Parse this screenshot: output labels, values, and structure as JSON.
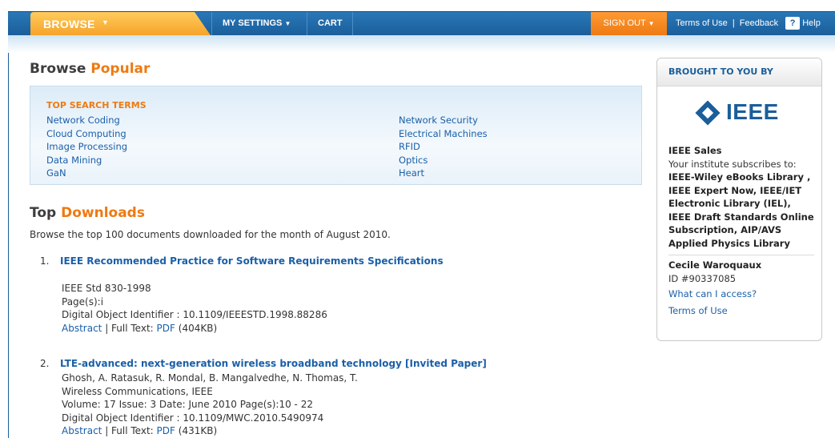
{
  "nav": {
    "browse": "BROWSE",
    "my_settings": "MY SETTINGS",
    "cart": "CART",
    "sign_out": "SIGN OUT",
    "terms_of_use": "Terms of Use",
    "divider": "|",
    "feedback": "Feedback",
    "help_icon_glyph": "?",
    "help": "Help"
  },
  "popular": {
    "title_plain": "Browse",
    "title_accent": "Popular",
    "heading": "TOP SEARCH TERMS",
    "left_terms": [
      "Network Coding",
      "Cloud Computing",
      "Image Processing",
      "Data Mining",
      "GaN"
    ],
    "right_terms": [
      "Network Security",
      "Electrical Machines",
      "RFID",
      "Optics",
      "Heart"
    ]
  },
  "downloads": {
    "title_plain": "Top",
    "title_accent": "Downloads",
    "intro": "Browse the top 100 documents downloaded for the month of August 2010.",
    "items": [
      {
        "num": "1.",
        "title": "IEEE Recommended Practice for Software Requirements Specifications",
        "line1": "IEEE Std 830-1998",
        "line2": "Page(s):i",
        "line3": "Digital Object Identifier : 10.1109/IEEESTD.1998.88286",
        "abstract": "Abstract",
        "fulltext_prefix": "| Full Text:",
        "pdf": "PDF",
        "size": "(404KB)"
      },
      {
        "num": "2.",
        "title": "LTE-advanced: next-generation wireless broadband technology [Invited Paper]",
        "line1": "Ghosh, A. Ratasuk, R. Mondal, B. Mangalvedhe, N. Thomas, T.",
        "line2": "Wireless Communications, IEEE",
        "line3": "Volume: 17 Issue: 3 Date: June 2010 Page(s):10 - 22",
        "line4": "Digital Object Identifier : 10.1109/MWC.2010.5490974",
        "abstract": "Abstract",
        "fulltext_prefix": "| Full Text:",
        "pdf": "PDF",
        "size": "(431KB)"
      }
    ]
  },
  "sidebar": {
    "header": "BROUGHT TO YOU BY",
    "logo_text": "IEEE",
    "org_name": "IEEE Sales",
    "subscribes_to": "Your institute subscribes to:",
    "subscriptions": "IEEE-Wiley eBooks Library , IEEE Expert Now, IEEE/IET Electronic Library (IEL), IEEE Draft Standards Online Subscription, AIP/AVS Applied Physics Library",
    "user_name": "Cecile Waroquaux",
    "user_id": "ID #90337085",
    "what_access": "What can I access?",
    "terms": "Terms of Use"
  },
  "colors": {
    "nav_blue": "#1a5e9a",
    "accent_orange": "#ee7a12",
    "link_blue": "#1a5fa8"
  }
}
